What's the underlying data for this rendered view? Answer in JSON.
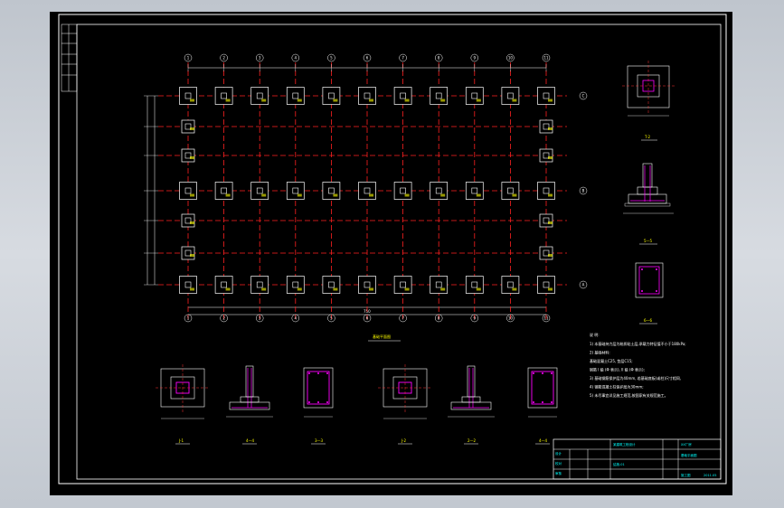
{
  "drawing": {
    "plan_title": "基础平面图",
    "column_grid": [
      "1",
      "2",
      "3",
      "4",
      "5",
      "6",
      "7",
      "8",
      "9",
      "10",
      "11"
    ],
    "row_grid": [
      "C",
      "B",
      "A"
    ],
    "overall_dimension": "750",
    "section_labels": {
      "top_right_plan": "T-2",
      "sec_44": "4—4",
      "sec_55": "5—5",
      "sec_66": "6—6",
      "bottom_1": "J-1",
      "bottom_2": "1—1",
      "bottom_3": "3—3",
      "bottom_4": "J-2",
      "bottom_5": "2—2",
      "bottom_6": "4—4"
    },
    "notes_title": "说  明:",
    "notes": [
      "1) 本基础持力层为粉质粘土层,承载力特征值不小于180kPa;",
      "2) 基础材料:",
      "   基础混凝土C25, 垫层C15;",
      "   钢筋 I 级 (Φ 表示), II 级 (Φ 表示);",
      "3) 基础钢筋保护层为40mm, 若基础底板(或柱)尺寸相同,",
      "4) 钢筋混凝土柱保护层为30mm;",
      "5) 未尽事宜详见施工规范,按国家有关规范施工。"
    ],
    "title_block": {
      "school": "某建筑工程设计",
      "project": "XX厂房",
      "drawing_name": "基础平面图",
      "stage": "施工图",
      "sheet_no": "结施-01",
      "date": "2011.05",
      "rows": [
        "设计",
        "校对",
        "审核",
        "审定",
        "专业"
      ]
    }
  }
}
